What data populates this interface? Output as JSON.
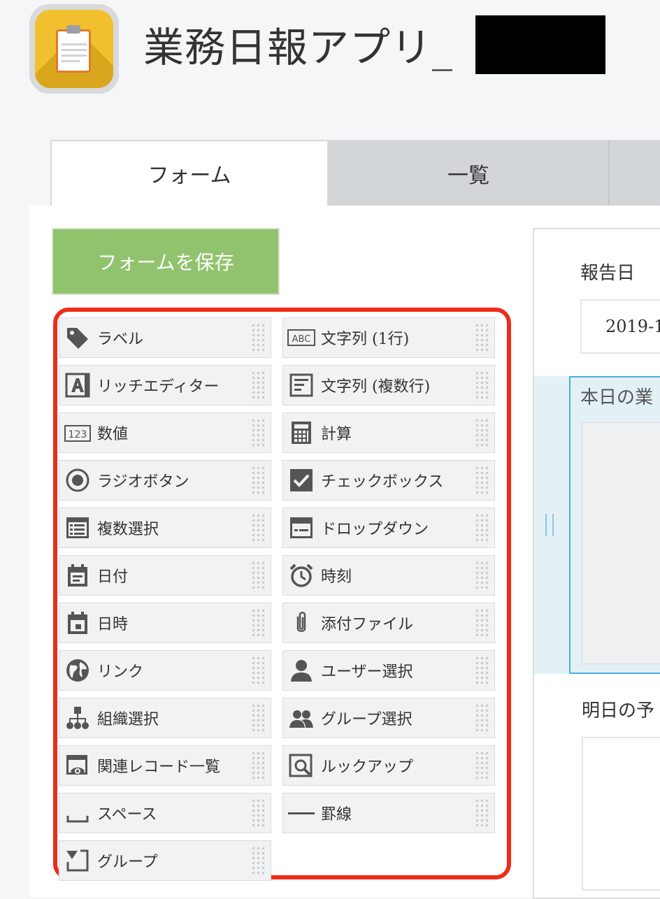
{
  "app": {
    "title": "業務日報アプリ_"
  },
  "tabs": [
    {
      "label": "フォーム",
      "active": true
    },
    {
      "label": "一覧",
      "active": false
    }
  ],
  "toolbar": {
    "save_label": "フォームを保存"
  },
  "palette": {
    "left": [
      {
        "label": "ラベル",
        "icon": "tag-icon"
      },
      {
        "label": "リッチエディター",
        "icon": "rich-editor-icon"
      },
      {
        "label": "数値",
        "icon": "number-icon"
      },
      {
        "label": "ラジオボタン",
        "icon": "radio-icon"
      },
      {
        "label": "複数選択",
        "icon": "multi-select-icon"
      },
      {
        "label": "日付",
        "icon": "calendar-icon"
      },
      {
        "label": "日時",
        "icon": "datetime-icon"
      },
      {
        "label": "リンク",
        "icon": "globe-icon"
      },
      {
        "label": "組織選択",
        "icon": "org-chart-icon"
      },
      {
        "label": "関連レコード一覧",
        "icon": "related-records-icon"
      },
      {
        "label": "スペース",
        "icon": "space-icon"
      },
      {
        "label": "グループ",
        "icon": "group-field-icon"
      }
    ],
    "right": [
      {
        "label": "文字列 (1行)",
        "icon": "abc-icon"
      },
      {
        "label": "文字列 (複数行)",
        "icon": "multiline-text-icon"
      },
      {
        "label": "計算",
        "icon": "calculator-icon"
      },
      {
        "label": "チェックボックス",
        "icon": "checkbox-icon"
      },
      {
        "label": "ドロップダウン",
        "icon": "dropdown-icon"
      },
      {
        "label": "時刻",
        "icon": "alarm-clock-icon"
      },
      {
        "label": "添付ファイル",
        "icon": "paperclip-icon"
      },
      {
        "label": "ユーザー選択",
        "icon": "user-icon"
      },
      {
        "label": "グループ選択",
        "icon": "users-icon"
      },
      {
        "label": "ルックアップ",
        "icon": "lookup-icon"
      },
      {
        "label": "罫線",
        "icon": "horizontal-line-icon"
      }
    ]
  },
  "form": {
    "report_date_label": "報告日",
    "report_date_value": "2019-1",
    "today_work_label": "本日の業",
    "tomorrow_plan_label": "明日の予"
  },
  "colors": {
    "save_button": "#91c36f",
    "highlight_frame": "#ef2b1a",
    "selected_field_border": "#49aee4",
    "icon_gray": "#555555"
  }
}
